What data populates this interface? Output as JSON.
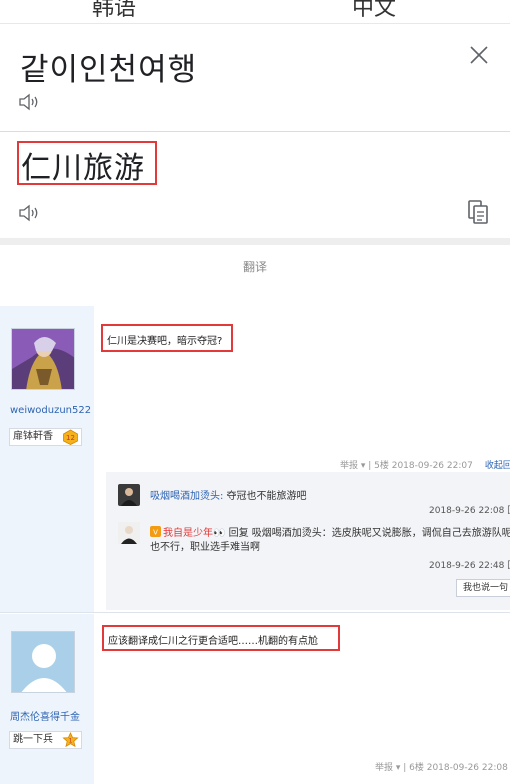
{
  "translator": {
    "tab_left": "韩语",
    "tab_right": "中文",
    "source_text": "같이인천여행",
    "target_text": "仁川旅游",
    "translate_label": "翻译"
  },
  "forum": {
    "post1": {
      "username": "weiwoduzun522",
      "rank": "扉钵軒香",
      "rank_level": "12",
      "content": "仁川是决赛吧，暗示夺冠?",
      "meta": "举报 ▾ | 5楼  2018-09-26 22:07",
      "collapse": "收起回",
      "replies": [
        {
          "name": "吸烟喝酒加烫头:",
          "text": " 夺冠也不能旅游吧",
          "time": "2018-9-26 22:08  回"
        },
        {
          "name": "我自是少年👀",
          "text": " 回复 吸烟喝酒加烫头：选皮肤呢又说膨胀，调侃自己去旅游队呢",
          "text2": "也不行，职业选手难当啊",
          "time": "2018-9-26 22:48  回"
        }
      ],
      "reply_button": "我也说一句"
    },
    "post2": {
      "username": "周杰伦喜得千金",
      "rank": "跳一下兵",
      "rank_level": "1",
      "content": "应该翻译成仁川之行更合适吧……机翻的有点尬",
      "meta": "举报 ▾ | 6楼  2018-09-26 22:08"
    }
  },
  "colors": {
    "highlight_border": "#e23a3a",
    "link_blue": "#2d64b3",
    "sidebar_bg": "#eef4fb"
  }
}
